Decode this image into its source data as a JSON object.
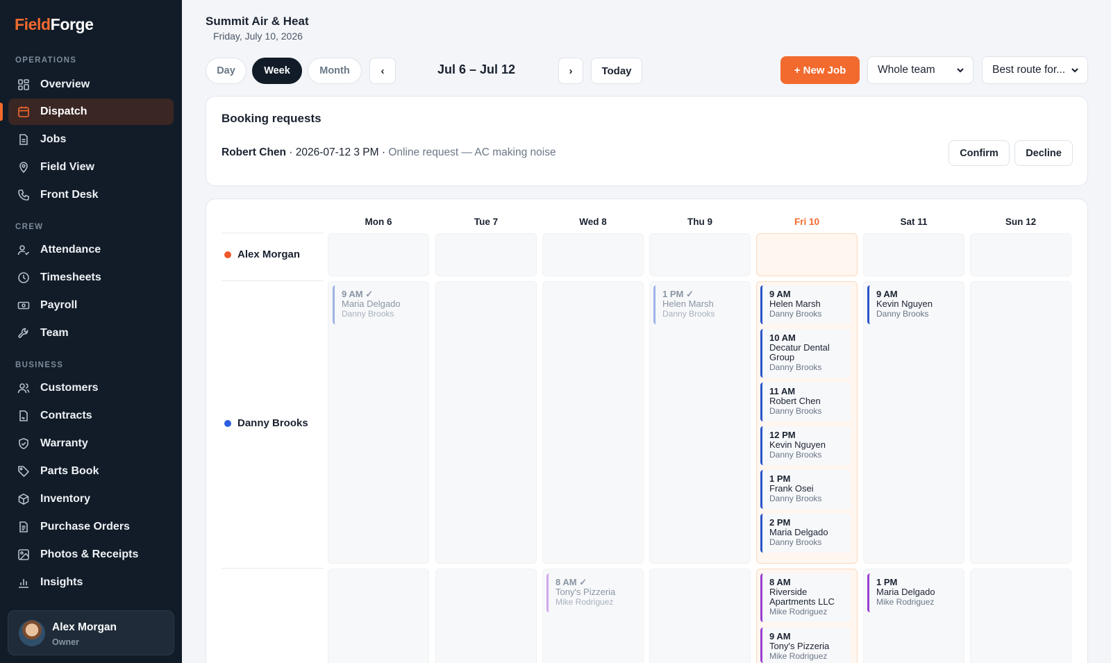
{
  "brand": {
    "part1": "Field",
    "part2": "Forge"
  },
  "sidebar": {
    "sections": {
      "operations": "OPERATIONS",
      "crew": "CREW",
      "business": "BUSINESS"
    },
    "items": [
      {
        "label": "Overview",
        "icon": "grid-icon"
      },
      {
        "label": "Dispatch",
        "icon": "calendar-icon",
        "active": true
      },
      {
        "label": "Jobs",
        "icon": "document-icon"
      },
      {
        "label": "Field View",
        "icon": "map-pin-icon"
      },
      {
        "label": "Front Desk",
        "icon": "phone-icon"
      },
      {
        "label": "Attendance",
        "icon": "user-check-icon"
      },
      {
        "label": "Timesheets",
        "icon": "clock-icon"
      },
      {
        "label": "Payroll",
        "icon": "money-icon"
      },
      {
        "label": "Team",
        "icon": "wrench-icon"
      },
      {
        "label": "Customers",
        "icon": "users-icon"
      },
      {
        "label": "Contracts",
        "icon": "contract-icon"
      },
      {
        "label": "Warranty",
        "icon": "shield-icon"
      },
      {
        "label": "Parts Book",
        "icon": "tag-icon"
      },
      {
        "label": "Inventory",
        "icon": "box-icon"
      },
      {
        "label": "Purchase Orders",
        "icon": "document-icon"
      },
      {
        "label": "Photos & Receipts",
        "icon": "image-icon"
      },
      {
        "label": "Insights",
        "icon": "bar-chart-icon"
      }
    ],
    "user": {
      "name": "Alex Morgan",
      "role": "Owner"
    }
  },
  "header": {
    "company": "Summit Air & Heat",
    "date": "Friday, July 10, 2026",
    "views": [
      "Day",
      "Week",
      "Month"
    ],
    "active_view": "Week",
    "prev": "‹",
    "next": "›",
    "range": "Jul 6 – Jul 12",
    "today": "Today",
    "new_job": "+ New Job",
    "team_select": "Whole team",
    "route_select": "Best route for..."
  },
  "booking": {
    "title": "Booking requests",
    "request": {
      "name": "Robert Chen",
      "when": " · 2026-07-12 3 PM · ",
      "source": "Online request — AC making noise"
    },
    "confirm": "Confirm",
    "decline": "Decline"
  },
  "calendar": {
    "days": [
      "Mon 6",
      "Tue 7",
      "Wed 8",
      "Thu 9",
      "Fri 10",
      "Sat 11",
      "Sun 12"
    ],
    "today_index": 4,
    "rows": [
      {
        "tech": "Alex Morgan",
        "color": "#f0582a"
      },
      {
        "tech": "Danny Brooks",
        "color": "#2b5ee0"
      }
    ],
    "jobs": {
      "danny": [
        {
          "day": 0,
          "time": "9 AM ✓",
          "customer": "Maria Delgado",
          "tech": "Danny Brooks",
          "done": true
        },
        {
          "day": 3,
          "time": "1 PM ✓",
          "customer": "Helen Marsh",
          "tech": "Danny Brooks",
          "done": true
        },
        {
          "day": 4,
          "time": "9 AM",
          "customer": "Helen Marsh",
          "tech": "Danny Brooks"
        },
        {
          "day": 4,
          "time": "10 AM",
          "customer": "Decatur Dental Group",
          "tech": "Danny Brooks"
        },
        {
          "day": 4,
          "time": "11 AM",
          "customer": "Robert Chen",
          "tech": "Danny Brooks"
        },
        {
          "day": 4,
          "time": "12 PM",
          "customer": "Kevin Nguyen",
          "tech": "Danny Brooks"
        },
        {
          "day": 4,
          "time": "1 PM",
          "customer": "Frank Osei",
          "tech": "Danny Brooks"
        },
        {
          "day": 4,
          "time": "2 PM",
          "customer": "Maria Delgado",
          "tech": "Danny Brooks"
        },
        {
          "day": 5,
          "time": "9 AM",
          "customer": "Kevin Nguyen",
          "tech": "Danny Brooks"
        }
      ],
      "mike": [
        {
          "day": 2,
          "time": "8 AM ✓",
          "customer": "Tony's Pizzeria",
          "tech": "Mike Rodriguez",
          "done": true
        },
        {
          "day": 4,
          "time": "8 AM",
          "customer": "Riverside Apartments LLC",
          "tech": "Mike Rodriguez"
        },
        {
          "day": 4,
          "time": "9 AM",
          "customer": "Tony's Pizzeria",
          "tech": "Mike Rodriguez"
        },
        {
          "day": 5,
          "time": "1 PM",
          "customer": "Maria Delgado",
          "tech": "Mike Rodriguez"
        }
      ]
    }
  },
  "colors": {
    "accent": "#f26a2e",
    "sidebar": "#121c28",
    "job_blue": "#2b54c7",
    "job_purple": "#9b3fd0"
  }
}
